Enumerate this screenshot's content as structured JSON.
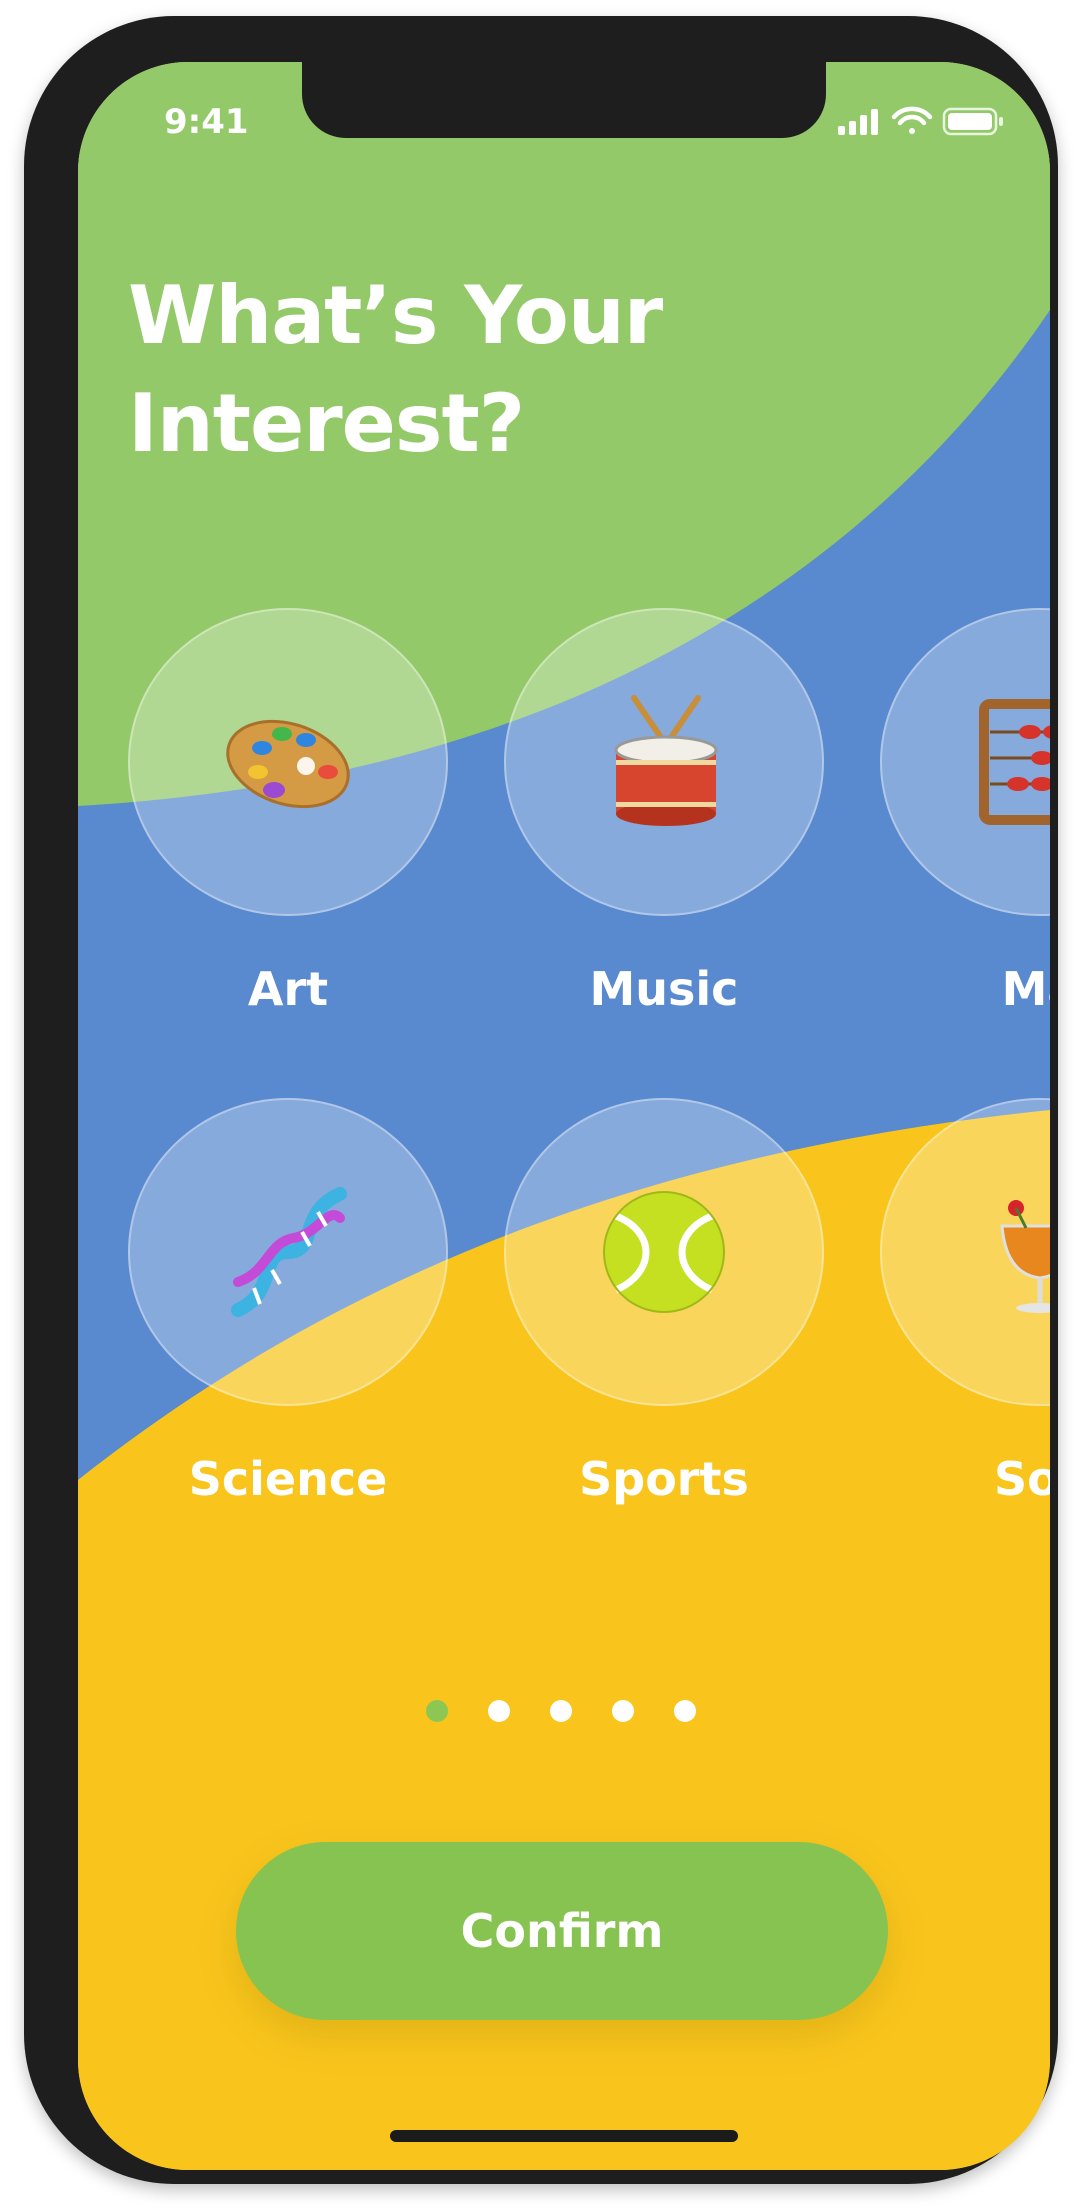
{
  "status": {
    "time": "9:41"
  },
  "title": {
    "line1": "What’s Your",
    "line2": "Interest?"
  },
  "interests": [
    {
      "label": "Art",
      "icon": "palette-icon"
    },
    {
      "label": "Music",
      "icon": "drum-icon"
    },
    {
      "label": "Ma",
      "icon": "abacus-icon"
    },
    {
      "label": "Science",
      "icon": "dna-icon"
    },
    {
      "label": "Sports",
      "icon": "tennis-ball-icon"
    },
    {
      "label": "Soc",
      "icon": "cocktail-icon"
    }
  ],
  "pagination": {
    "count": 5,
    "active_index": 0
  },
  "confirm_label": "Confirm",
  "colors": {
    "green": "#93c968",
    "blue": "#5989cf",
    "yellow": "#f9c51c",
    "button": "#86c350"
  }
}
